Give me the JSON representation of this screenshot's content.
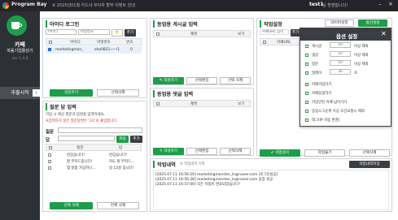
{
  "colors": {
    "accent": "#1f9d4a",
    "titlebar": "#24242a",
    "sidebar": "#2d3035",
    "selected_menu": "#4b4f55",
    "dark_button": "#3a3d42"
  },
  "titlebar": {
    "app_name": "Program Bay",
    "notice": "※ 2025년01월 카드사 무이자 할부 이벤트 안내",
    "user": "test1",
    "user_suffix": "님 환영합니다!",
    "minimize": "–",
    "close": "×"
  },
  "sidebar": {
    "brand_name": "카페",
    "brand_sub": "자동기업활성기",
    "version": "ver 1.4.0",
    "menu_item": "추출시작",
    "collapse": "‹"
  },
  "login": {
    "title": "아이디 로그인",
    "id_placeholder": "아이디",
    "pw_placeholder": "비밀번호",
    "add_button": "추가",
    "headers": {
      "id": "아이디",
      "pw": "비밀번호",
      "no": "번호"
    },
    "rows": [
      {
        "id": "marketingmon_",
        "pw": "ehx0821~~!1",
        "no": "0"
      }
    ],
    "check_button": "검증하기",
    "delete_button": "선택삭제"
  },
  "question": {
    "title": "질문 답 입력",
    "desc": "가입 시 예상 질문과 답변을 입력하세요.",
    "warning": "※입력하지 않은 질문답변은 '1로'로 출입합니다.",
    "q_label": "질문",
    "a_label": "답",
    "upload_button": "파일",
    "add_button": "추가",
    "headers": {
      "q": "질문",
      "a": "답"
    },
    "rows": [
      {
        "q": "반갑습니다!",
        "a": "반갑습니다!"
      },
      {
        "q": "잘 부탁드립니다!",
        "a": "저도 잘 부탁드..."
      },
      {
        "q": "몇 살쯤 가입하나...",
        "a": "일 12살 입니다!"
      }
    ],
    "delete_button": "선택 삭제",
    "delete_all_button": "전체 삭제"
  },
  "post_board": {
    "title": "등업용 게시글 입력",
    "headers": {
      "title": "제목",
      "view": "보기"
    },
    "write_button": "✎ 작성하기",
    "edit_button": "선택편집",
    "delete_button": "선택 삭제"
  },
  "comment_board": {
    "title": "등업용 댓글 입력",
    "headers": {
      "title": "제목",
      "view": "보기"
    },
    "write_button": "✎ 작성하기",
    "edit_button": "선택편집",
    "delete_button": "선택삭제"
  },
  "work_settings": {
    "title": "작업설정",
    "naver_button": "네이버설정",
    "option_button": "옵션설정",
    "search_placeholder": "카페URL 입력",
    "add_button": "추가",
    "headers": {
      "url": "카페URL"
    },
    "write_button": "✔ 작업설치",
    "load_button": "작업불기",
    "delete_button": "선택삭제"
  },
  "option_modal": {
    "title": "옵션 설정",
    "close": "✕",
    "rows": [
      {
        "label": "게시글",
        "value": "10",
        "suffix": "이상 제외"
      },
      {
        "label": "댓글",
        "value": "10",
        "suffix": "이상 제외"
      },
      {
        "label": "방문",
        "value": "10",
        "suffix": "이상 제외"
      },
      {
        "label": "딜레이",
        "value": "30",
        "suffix": "초"
      }
    ],
    "checks": [
      "카페가입하기",
      "카페등업하기",
      "가입안된 카페 넘어가기",
      "등업시 1순위 이상 조건요청시 제외",
      "태그(IP 자동 변경)"
    ]
  },
  "log": {
    "title": "작업내역",
    "sub": "※ 작업내역 기록",
    "save_button": "작업내역저장",
    "lines": [
      "[2025.07.11 16:56:20] marketingmonster_ln@naver.com [로그인성공]",
      "[2025.07.11 16:56:38] marketingmonster_ln@naver.com 등업 성공",
      "[2025.07.11 16:57:00] 모든 작업이 완료되었습니다!"
    ]
  }
}
